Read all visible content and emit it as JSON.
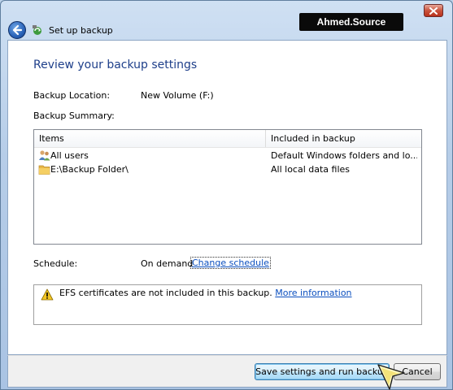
{
  "window": {
    "title": "Set up backup",
    "watermark": "Ahmed.Source"
  },
  "page": {
    "heading": "Review your backup settings",
    "location_label": "Backup Location:",
    "location_value": "New Volume (F:)",
    "summary_label": "Backup Summary:"
  },
  "summary_table": {
    "columns": [
      "Items",
      "Included in backup"
    ],
    "rows": [
      {
        "icon": "users-icon",
        "item": "All users",
        "included": "Default Windows folders and lo..."
      },
      {
        "icon": "folder-icon",
        "item": "E:\\Backup Folder\\",
        "included": "All local data files"
      }
    ]
  },
  "schedule": {
    "label": "Schedule:",
    "value": "On demand",
    "link": "Change schedule"
  },
  "notice": {
    "icon": "warning-icon",
    "text": "EFS certificates are not included in this backup.",
    "link": "More information"
  },
  "footer": {
    "primary_button": "Save settings and run backup",
    "cancel_button": "Cancel"
  },
  "colors": {
    "heading": "#1e3f8a",
    "link": "#0b4fbf",
    "primary_border": "#3c7fb1"
  }
}
